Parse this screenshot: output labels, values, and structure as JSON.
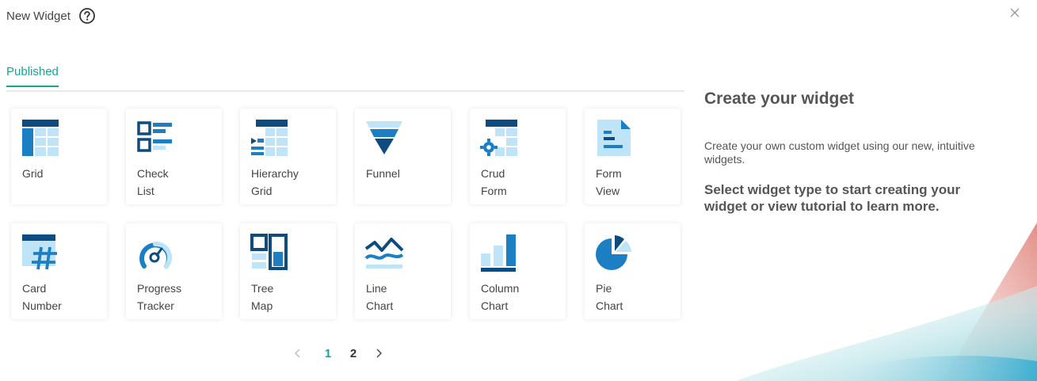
{
  "header": {
    "title": "New Widget",
    "help_icon": "help-circle-icon",
    "close_icon": "close-icon"
  },
  "tabs": [
    {
      "label": "Published",
      "active": true
    }
  ],
  "widgets": [
    {
      "line1": "Grid",
      "line2": "",
      "icon": "grid-icon"
    },
    {
      "line1": "Check",
      "line2": "List",
      "icon": "checklist-icon"
    },
    {
      "line1": "Hierarchy",
      "line2": "Grid",
      "icon": "hierarchy-grid-icon"
    },
    {
      "line1": "Funnel",
      "line2": "",
      "icon": "funnel-icon"
    },
    {
      "line1": "Crud",
      "line2": "Form",
      "icon": "crud-form-icon"
    },
    {
      "line1": "Form",
      "line2": "View",
      "icon": "form-view-icon"
    },
    {
      "line1": "Card",
      "line2": "Number",
      "icon": "card-number-icon"
    },
    {
      "line1": "Progress",
      "line2": "Tracker",
      "icon": "progress-tracker-icon"
    },
    {
      "line1": "Tree",
      "line2": "Map",
      "icon": "tree-map-icon"
    },
    {
      "line1": "Line",
      "line2": "Chart",
      "icon": "line-chart-icon"
    },
    {
      "line1": "Column",
      "line2": "Chart",
      "icon": "column-chart-icon"
    },
    {
      "line1": "Pie",
      "line2": "Chart",
      "icon": "pie-chart-icon"
    }
  ],
  "pagination": {
    "prev": "‹",
    "pages": [
      "1",
      "2"
    ],
    "current": "1",
    "next": "›"
  },
  "side": {
    "title": "Create your widget",
    "description": "Create your own custom widget using our new, intuitive widgets.",
    "cta": "Select widget type to start creating your widget or view tutorial to learn more."
  },
  "colors": {
    "accent": "#17a591",
    "icon_dark": "#0e4b7f",
    "icon_mid": "#1c7fc4",
    "icon_light": "#bfe3f7"
  }
}
